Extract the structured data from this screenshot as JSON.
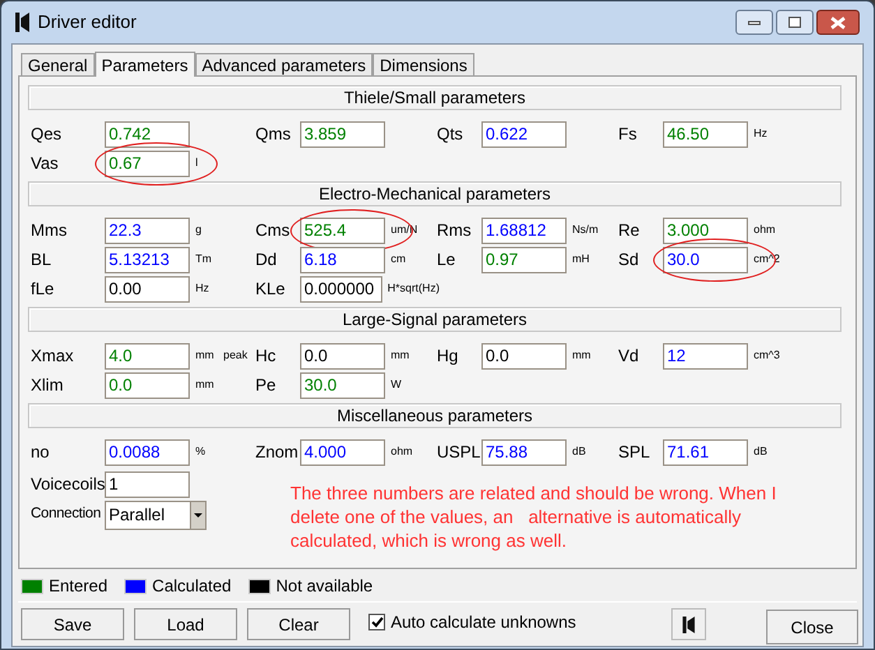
{
  "window": {
    "title": "Driver editor"
  },
  "tabs": [
    {
      "label": "General",
      "selected": false
    },
    {
      "label": "Parameters",
      "selected": true
    },
    {
      "label": "Advanced parameters",
      "selected": false
    },
    {
      "label": "Dimensions",
      "selected": false
    }
  ],
  "sections": [
    {
      "title": "Thiele/Small parameters",
      "rows": [
        [
          {
            "label": "Qes",
            "value": "0.742",
            "kind": "entered",
            "circled": false
          },
          {
            "label": "Qms",
            "value": "3.859",
            "kind": "entered",
            "circled": false
          },
          {
            "label": "Qts",
            "value": "0.622",
            "kind": "calculated",
            "circled": false
          },
          {
            "label": "Fs",
            "value": "46.50",
            "unit": "Hz",
            "kind": "entered",
            "circled": false
          }
        ],
        [
          {
            "label": "Vas",
            "value": "0.67",
            "unit": "l",
            "kind": "entered",
            "circled": true
          }
        ]
      ]
    },
    {
      "title": "Electro-Mechanical parameters",
      "rows": [
        [
          {
            "label": "Mms",
            "value": "22.3",
            "unit": "g",
            "kind": "calculated",
            "circled": false
          },
          {
            "label": "Cms",
            "value": "525.4",
            "unit": "um/N",
            "kind": "entered",
            "circled": true
          },
          {
            "label": "Rms",
            "value": "1.68812",
            "unit": "Ns/m",
            "kind": "calculated",
            "circled": false
          },
          {
            "label": "Re",
            "value": "3.000",
            "unit": "ohm",
            "kind": "entered",
            "circled": false
          }
        ],
        [
          {
            "label": "BL",
            "value": "5.13213",
            "unit": "Tm",
            "kind": "calculated",
            "circled": false
          },
          {
            "label": "Dd",
            "value": "6.18",
            "unit": "cm",
            "kind": "calculated",
            "circled": false
          },
          {
            "label": "Le",
            "value": "0.97",
            "unit": "mH",
            "kind": "entered",
            "circled": false
          },
          {
            "label": "Sd",
            "value": "30.0",
            "unit": "cm^2",
            "kind": "calculated",
            "circled": true
          }
        ],
        [
          {
            "label": "fLe",
            "value": "0.00",
            "unit": "Hz",
            "kind": "plain",
            "circled": false
          },
          {
            "label": "KLe",
            "value": "0.000000",
            "unit": "H*sqrt(Hz)",
            "kind": "plain",
            "circled": false
          }
        ]
      ]
    },
    {
      "title": "Large-Signal parameters",
      "rows": [
        [
          {
            "label": "Xmax",
            "value": "4.0",
            "unit": "mm   peak",
            "kind": "entered",
            "circled": false
          },
          {
            "label": "Hc",
            "value": "0.0",
            "unit": "mm",
            "kind": "plain",
            "circled": false
          },
          {
            "label": "Hg",
            "value": "0.0",
            "unit": "mm",
            "kind": "plain",
            "circled": false
          },
          {
            "label": "Vd",
            "value": "12",
            "unit": "cm^3",
            "kind": "calculated",
            "circled": false
          }
        ],
        [
          {
            "label": "Xlim",
            "value": "0.0",
            "unit": "mm",
            "kind": "entered",
            "circled": false
          },
          {
            "label": "Pe",
            "value": "30.0",
            "unit": "W",
            "kind": "entered",
            "circled": false
          }
        ]
      ]
    },
    {
      "title": "Miscellaneous parameters",
      "rows": [
        [
          {
            "label": "no",
            "value": "0.0088",
            "unit": "%",
            "kind": "calculated",
            "circled": false
          },
          {
            "label": "Znom",
            "value": "4.000",
            "unit": "ohm",
            "kind": "calculated",
            "circled": false
          },
          {
            "label": "USPL",
            "value": "75.88",
            "unit": "dB",
            "kind": "calculated",
            "circled": false
          },
          {
            "label": "SPL",
            "value": "71.61",
            "unit": "dB",
            "kind": "calculated",
            "circled": false
          }
        ]
      ]
    }
  ],
  "voicecoils": {
    "label": "Voicecoils",
    "value": "1"
  },
  "connection": {
    "label": "Connection",
    "value": "Parallel"
  },
  "note_lines": [
    "The three numbers are related and should be wrong. When I",
    "delete one of the values, an   alternative is automatically",
    "calculated, which is wrong as well."
  ],
  "legend": [
    {
      "label": "Entered",
      "color": "#008000"
    },
    {
      "label": "Calculated",
      "color": "#0000ff"
    },
    {
      "label": "Not available",
      "color": "#000000"
    }
  ],
  "buttons": [
    "Save",
    "Load",
    "Clear"
  ],
  "auto_calculate": {
    "label": "Auto calculate unknowns",
    "checked": true
  },
  "close_button": "Close"
}
